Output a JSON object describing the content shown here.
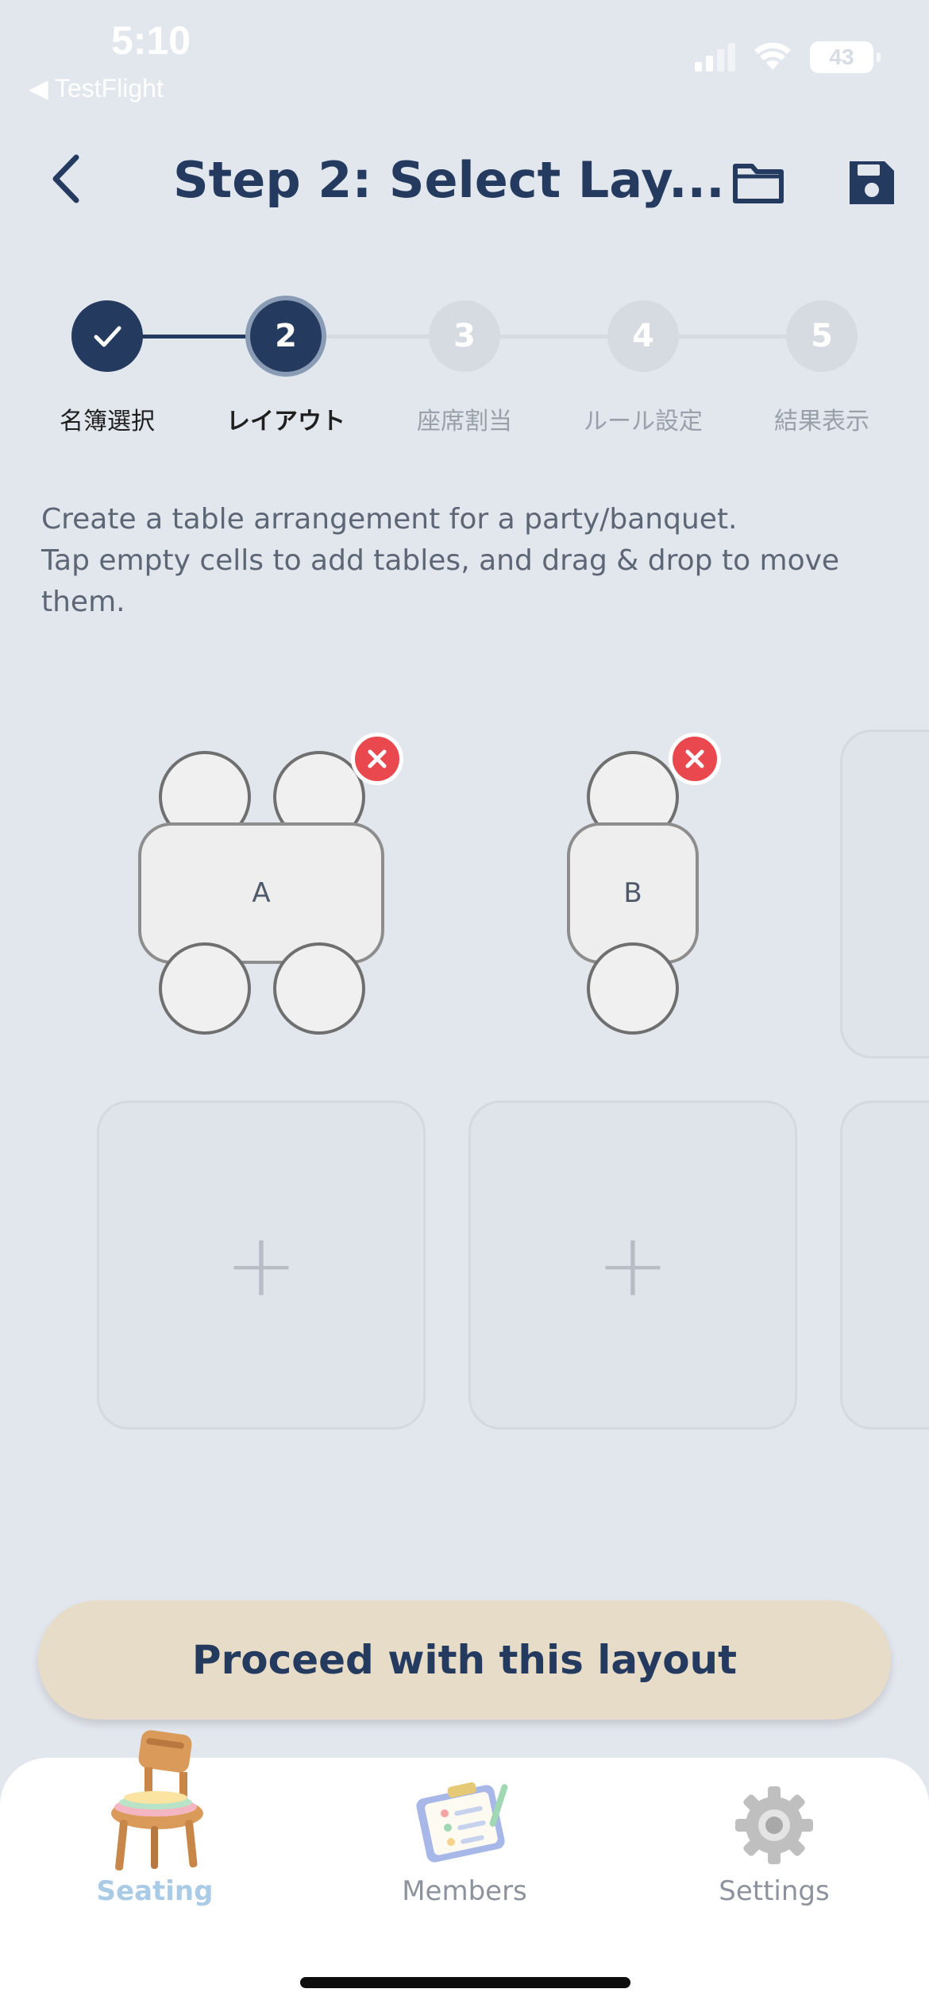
{
  "status_bar": {
    "time": "5:10",
    "back_app": "◀ TestFlight",
    "battery": "43"
  },
  "header": {
    "title": "Step 2: Select Lay...",
    "back_icon": "chevron-left-icon",
    "folder_icon": "folder-icon",
    "save_icon": "floppy-disk-icon"
  },
  "stepper": {
    "steps": [
      {
        "number": "1",
        "label": "名簿選択",
        "state": "done"
      },
      {
        "number": "2",
        "label": "レイアウト",
        "state": "current"
      },
      {
        "number": "3",
        "label": "座席割当",
        "state": "upcoming"
      },
      {
        "number": "4",
        "label": "ルール設定",
        "state": "upcoming"
      },
      {
        "number": "5",
        "label": "結果表示",
        "state": "upcoming"
      }
    ]
  },
  "description": {
    "line1": "Create a table arrangement for a party/banquet.",
    "line2": "Tap empty cells to add tables, and drag & drop to move them."
  },
  "layout_grid": {
    "tables": [
      {
        "label": "A",
        "seats": 4
      },
      {
        "label": "B",
        "seats": 2
      }
    ],
    "add_symbol": "+"
  },
  "proceed_button": "Proceed with this layout",
  "tabbar": {
    "tabs": [
      {
        "label": "Seating",
        "icon": "chair-icon",
        "active": true
      },
      {
        "label": "Members",
        "icon": "clipboard-icon",
        "active": false
      },
      {
        "label": "Settings",
        "icon": "gear-icon",
        "active": false
      }
    ]
  },
  "colors": {
    "primary": "#243a5e",
    "background": "#e2e6ed",
    "button": "#e6dcc8",
    "remove": "#e9484f",
    "active_tab": "#a9cbe6"
  }
}
